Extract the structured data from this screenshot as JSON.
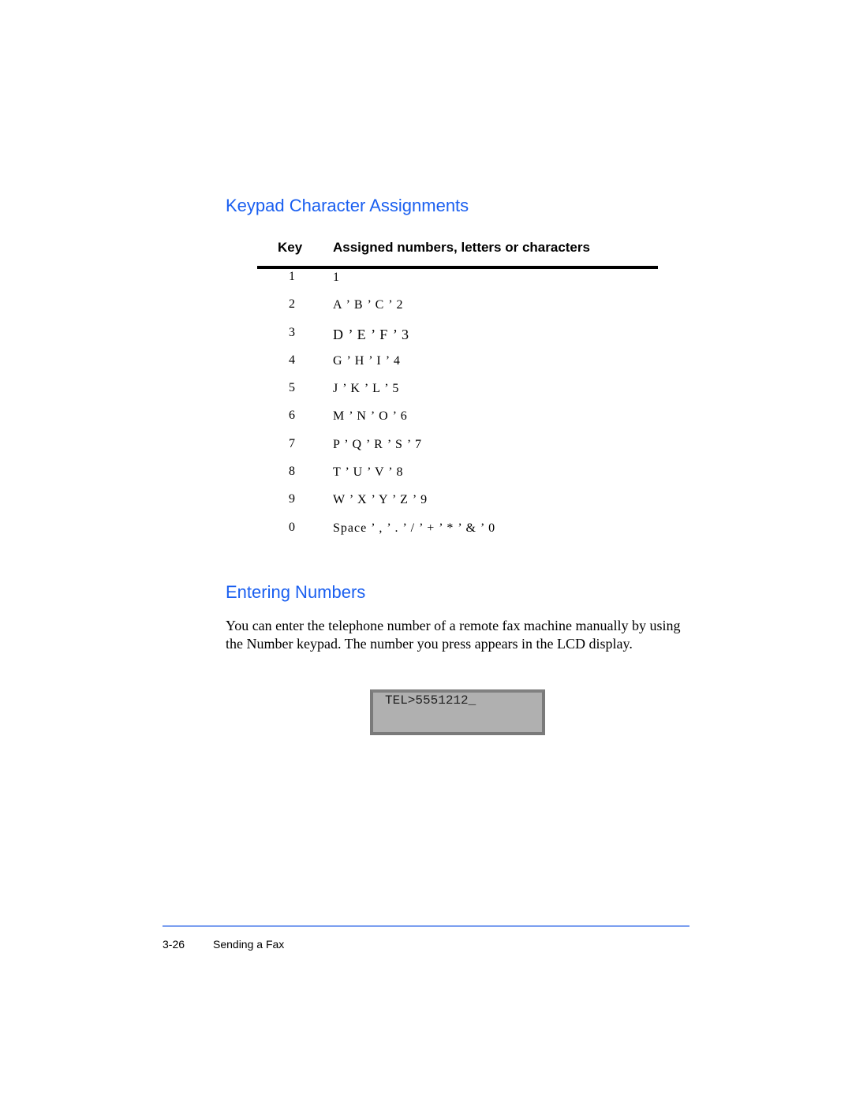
{
  "sections": {
    "keypad": {
      "title": "Keypad Character Assignments",
      "table": {
        "headers": {
          "key": "Key",
          "assigned": "Assigned numbers, letters or characters"
        },
        "rows": [
          {
            "key": "1",
            "assigned": "1"
          },
          {
            "key": "2",
            "assigned": "A ’ B ’ C ’ 2"
          },
          {
            "key": "3",
            "assigned": "D ’ E ’ F ’ 3"
          },
          {
            "key": "4",
            "assigned": "G ’ H ’ I ’ 4"
          },
          {
            "key": "5",
            "assigned": "J ’ K ’ L ’ 5"
          },
          {
            "key": "6",
            "assigned": "M ’ N ’ O ’ 6"
          },
          {
            "key": "7",
            "assigned": "P ’ Q ’ R ’ S ’ 7"
          },
          {
            "key": "8",
            "assigned": "T ’ U ’ V ’ 8"
          },
          {
            "key": "9",
            "assigned": "W ’ X ’ Y ’ Z ’ 9"
          },
          {
            "key": "0",
            "assigned": "Space ’ , ’ . ’ / ’ + ’ * ’ & ’ 0"
          }
        ]
      }
    },
    "entering": {
      "title": "Entering Numbers",
      "body": "You can enter the telephone number of a remote fax machine manually by using the Number keypad.  The number you press appears in the LCD display.",
      "lcd_text": "TEL>5551212_"
    }
  },
  "footer": {
    "page_number": "3-26",
    "chapter_title": "Sending a Fax"
  }
}
